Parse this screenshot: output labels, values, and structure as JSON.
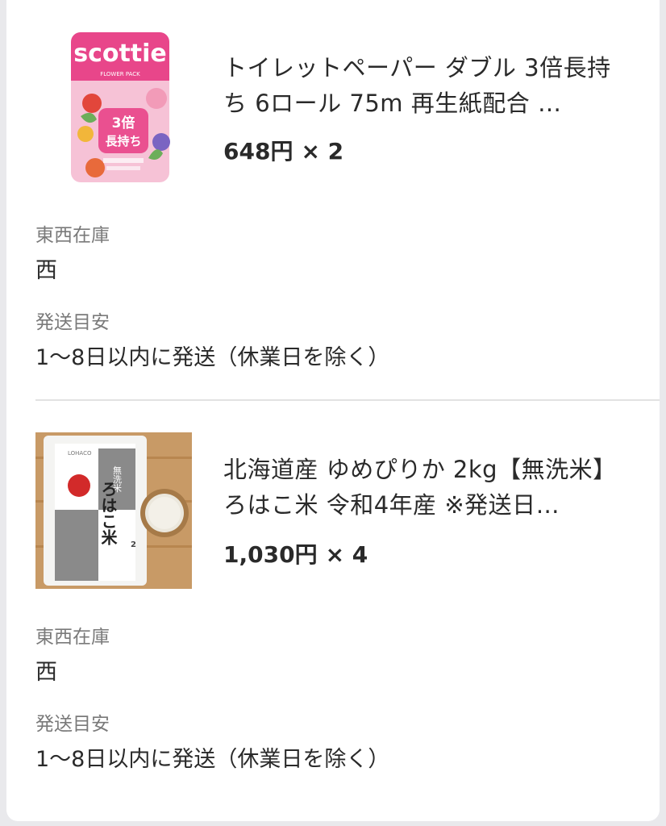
{
  "items": [
    {
      "image": {
        "brand_text": "scottie",
        "sub_text": "FLOWER PACK",
        "badge_top": "3倍",
        "badge_bottom": "長持ち",
        "colors": {
          "pink": "#e8468a",
          "light_pink": "#f6c2d6"
        }
      },
      "title": "トイレットペーパー ダブル 3倍長持ち 6ロール 75m 再生紙配合 …",
      "price": "648円",
      "quantity": "× 2",
      "stock_label": "東西在庫",
      "stock_value": "西",
      "ship_label": "発送目安",
      "ship_value": "1〜8日以内に発送（休業日を除く）"
    },
    {
      "image": {
        "brand_text": "LOHACO",
        "tag_text": "無洗米",
        "main_text": "ろはこ米",
        "weight_text": "2",
        "colors": {
          "wood": "#c89a66",
          "gray": "#8a8a8a",
          "red": "#d22a2a"
        }
      },
      "title": "北海道産 ゆめぴりか 2kg【無洗米】ろはこ米 令和4年産 ※発送日…",
      "price": "1,030円",
      "quantity": "× 4",
      "stock_label": "東西在庫",
      "stock_value": "西",
      "ship_label": "発送目安",
      "ship_value": "1〜8日以内に発送（休業日を除く）"
    }
  ]
}
